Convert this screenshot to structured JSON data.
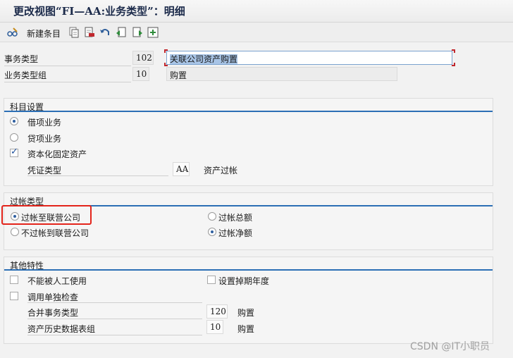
{
  "title": "更改视图“FI—AA:业务类型”：明细",
  "toolbar": {
    "new_entries_label": "新建条目",
    "icons": [
      "glasses-edit-icon",
      "copy-icon",
      "delete-icon",
      "undo-icon",
      "previous-entry-icon",
      "next-entry-icon",
      "select-icon"
    ]
  },
  "header": {
    "transaction_type_label": "事务类型",
    "transaction_type_code": "102",
    "transaction_type_desc": "关联公司资产购置",
    "transaction_group_label": "业务类型组",
    "transaction_group_code": "10",
    "transaction_group_desc": "购置"
  },
  "account_settings": {
    "title": "科目设置",
    "debit_label": "借项业务",
    "credit_label": "贷项业务",
    "capitalize_label": "资本化固定资产",
    "doc_type_label": "凭证类型",
    "doc_type_value": "AA",
    "doc_type_desc": "资产过帐",
    "debit_selected": true,
    "capitalize_checked": true
  },
  "posting_type": {
    "title": "过帐类型",
    "to_affiliate_label": "过帐至联营公司",
    "not_to_affiliate_label": "不过帐到联营公司",
    "gross_label": "过帐总额",
    "net_label": "过帐净额",
    "to_affiliate_selected": true,
    "net_selected": true
  },
  "other_features": {
    "title": "其他特性",
    "no_manual_label": "不能被人工使用",
    "call_check_label": "调用单独检查",
    "retire_year_label": "设置掉期年度",
    "consol_type_label": "合并事务类型",
    "consol_type_value": "120",
    "consol_type_desc": "购置",
    "history_group_label": "资产历史数据表组",
    "history_group_value": "10",
    "history_group_desc": "购置"
  },
  "watermark": "CSDN @IT小职员"
}
